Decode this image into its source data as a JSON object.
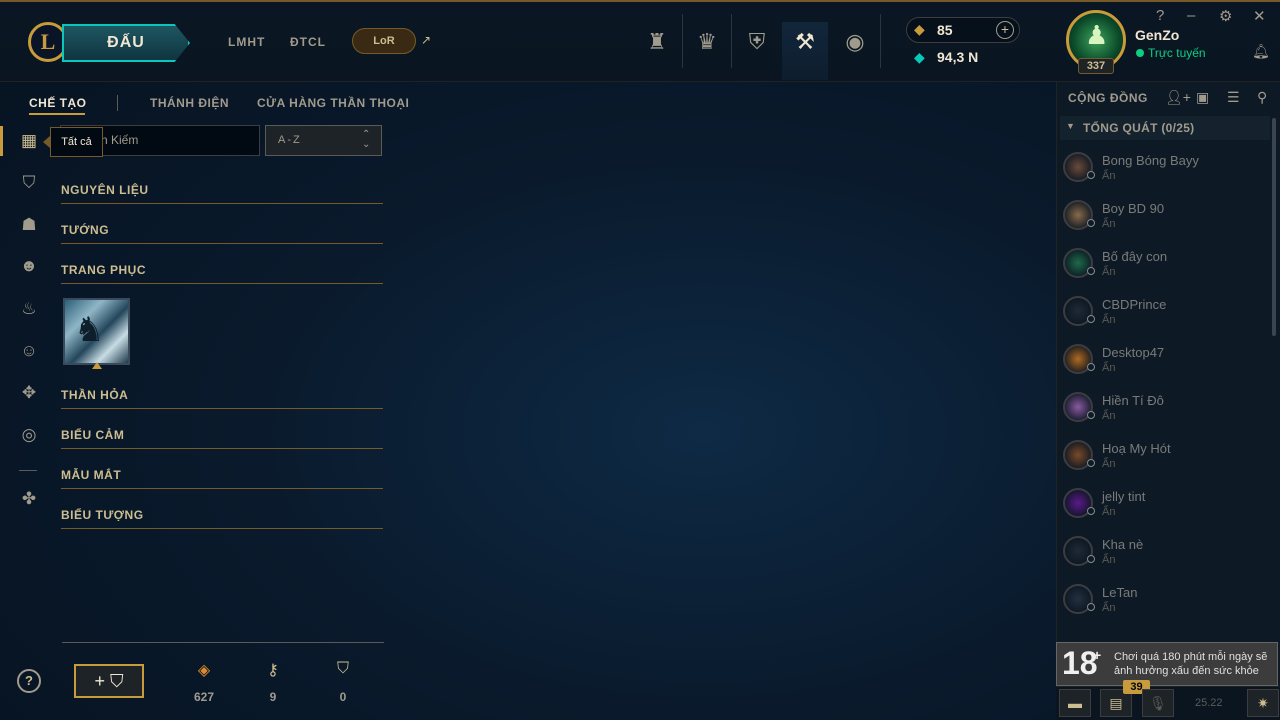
{
  "topbar": {
    "logo_letter": "L",
    "play_label": "ĐẤU",
    "nav": [
      "LMHT",
      "ĐTCL"
    ],
    "lor_label": "LoR",
    "lor_ext": "↗",
    "icons": [
      "trophy-icon",
      "ranked-icon",
      "loot-bag-icon",
      "crafting-icon",
      "store-icon"
    ],
    "rp": "85",
    "be": "94,3 N"
  },
  "profile": {
    "name": "GenZo",
    "status": "Trực tuyến",
    "level": "337"
  },
  "window": {
    "help": "?",
    "minimize": "–",
    "settings": "⚙",
    "close": "✕"
  },
  "crafting": {
    "tabs": [
      "CHẾ TẠO",
      "THÁNH ĐIỆN",
      "CỬA HÀNG THẦN THOẠI"
    ],
    "search_placeholder": "Tìm Kiếm",
    "search_visible": "n Kiếm",
    "sort": "A-Z",
    "tooltip": "Tất cả",
    "categories": [
      "NGUYÊN LIỆU",
      "TƯỚNG",
      "TRANG PHỤC",
      "THẦN HỎA",
      "BIỂU CẢM",
      "MẪU MẮT",
      "BIỂU TƯỢNG"
    ],
    "resources": [
      {
        "icon": "orange-essence-icon",
        "value": "627"
      },
      {
        "icon": "key-fragment-icon",
        "value": "9"
      },
      {
        "icon": "chest-icon",
        "value": "0"
      }
    ],
    "help": "?"
  },
  "social": {
    "title": "CỘNG ĐỒNG",
    "group": "TỔNG QUÁT (0/25)",
    "friends": [
      {
        "name": "Bong Bóng Bayy",
        "status": "Ẩn",
        "color": "#6a4a3a"
      },
      {
        "name": "Boy BD 90",
        "status": "Ẩn",
        "color": "#8a6a4a"
      },
      {
        "name": "Bố đây con",
        "status": "Ẩn",
        "color": "#1f6a4a"
      },
      {
        "name": "CBDPrince",
        "status": "Ẩn",
        "color": "#1e2a36"
      },
      {
        "name": "Desktop47",
        "status": "Ẩn",
        "color": "#b06a20"
      },
      {
        "name": "Hiền Tí Đô",
        "status": "Ẩn",
        "color": "#8a5aa0"
      },
      {
        "name": "Hoạ My Hót",
        "status": "Ẩn",
        "color": "#7a4a2a"
      },
      {
        "name": "jelly tint",
        "status": "Ẩn",
        "color": "#5a1a8a"
      },
      {
        "name": "Kha nè",
        "status": "Ẩn",
        "color": "#1e2a36"
      },
      {
        "name": "LeTan",
        "status": "Ẩn",
        "color": "#243040"
      }
    ],
    "age_rating": "18",
    "age_plus": "+",
    "age_warning": "Chơi quá 180 phút mỗi ngày sẽ ảnh hưởng xấu đến sức khỏe",
    "notification_count": "39",
    "version": "25.22"
  }
}
